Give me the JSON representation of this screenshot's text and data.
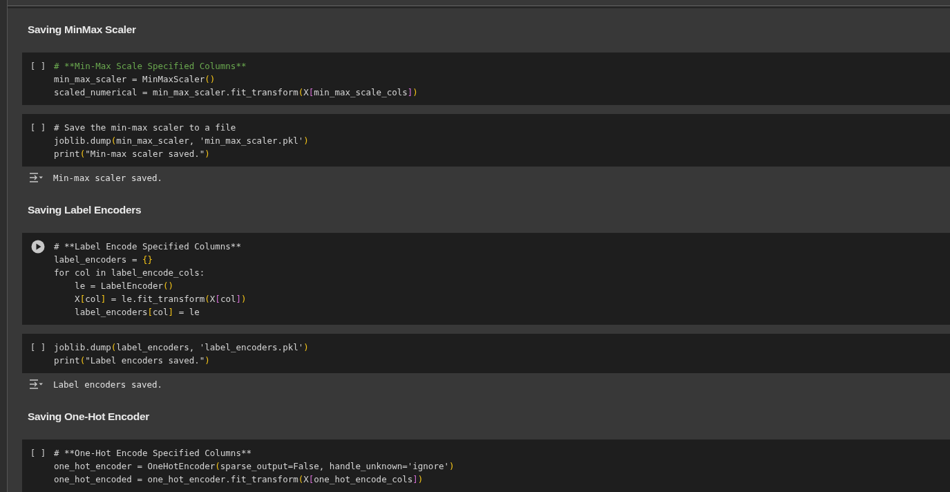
{
  "cells": [
    {
      "kind": "heading",
      "text": "Saving MinMax Scaler"
    },
    {
      "kind": "code",
      "prompt": "[ ]",
      "focused": false,
      "lines": [
        [
          {
            "text": "# **Min-Max Scale Specified Columns**",
            "kind": "comment"
          }
        ],
        [
          {
            "text": "min_max_scaler = MinMaxScaler",
            "kind": "plain"
          },
          {
            "text": "()",
            "kind": "paren"
          }
        ],
        [
          {
            "text": "scaled_numerical = min_max_scaler.fit_transform",
            "kind": "plain"
          },
          {
            "text": "(",
            "kind": "paren"
          },
          {
            "text": "X",
            "kind": "plain"
          },
          {
            "text": "[",
            "kind": "bracket"
          },
          {
            "text": "min_max_scale_cols",
            "kind": "plain"
          },
          {
            "text": "]",
            "kind": "bracket"
          },
          {
            "text": ")",
            "kind": "paren"
          }
        ]
      ]
    },
    {
      "kind": "code",
      "prompt": "[ ]",
      "focused": false,
      "lines": [
        [
          {
            "text": "# Save the min-max scaler to a file",
            "kind": "plain"
          }
        ],
        [
          {
            "text": "joblib.dump",
            "kind": "plain"
          },
          {
            "text": "(",
            "kind": "paren"
          },
          {
            "text": "min_max_scaler, 'min_max_scaler.pkl'",
            "kind": "plain"
          },
          {
            "text": ")",
            "kind": "paren"
          }
        ],
        [
          {
            "text": "print",
            "kind": "plain"
          },
          {
            "text": "(",
            "kind": "paren"
          },
          {
            "text": "\"Min-max scaler saved.\"",
            "kind": "plain"
          },
          {
            "text": ")",
            "kind": "paren"
          }
        ]
      ],
      "output": "Min-max scaler saved."
    },
    {
      "kind": "heading",
      "text": "Saving Label Encoders"
    },
    {
      "kind": "code",
      "focused": true,
      "lines": [
        [
          {
            "text": "# **Label Encode Specified Columns**",
            "kind": "plain"
          }
        ],
        [
          {
            "text": "label_encoders = ",
            "kind": "plain"
          },
          {
            "text": "{}",
            "kind": "paren"
          }
        ],
        [
          {
            "text": "for col in label_encode_cols:",
            "kind": "plain"
          }
        ],
        [
          {
            "text": "    le = LabelEncoder",
            "kind": "plain"
          },
          {
            "text": "()",
            "kind": "paren"
          }
        ],
        [
          {
            "text": "    X",
            "kind": "plain"
          },
          {
            "text": "[",
            "kind": "paren"
          },
          {
            "text": "col",
            "kind": "plain"
          },
          {
            "text": "]",
            "kind": "paren"
          },
          {
            "text": " = le.fit_transform",
            "kind": "plain"
          },
          {
            "text": "(",
            "kind": "paren"
          },
          {
            "text": "X",
            "kind": "plain"
          },
          {
            "text": "[",
            "kind": "bracket"
          },
          {
            "text": "col",
            "kind": "plain"
          },
          {
            "text": "]",
            "kind": "bracket"
          },
          {
            "text": ")",
            "kind": "paren"
          }
        ],
        [
          {
            "text": "    label_encoders",
            "kind": "plain"
          },
          {
            "text": "[",
            "kind": "paren"
          },
          {
            "text": "col",
            "kind": "plain"
          },
          {
            "text": "]",
            "kind": "paren"
          },
          {
            "text": " = le",
            "kind": "plain"
          }
        ]
      ]
    },
    {
      "kind": "code",
      "prompt": "[ ]",
      "focused": false,
      "lines": [
        [
          {
            "text": "joblib.dump",
            "kind": "plain"
          },
          {
            "text": "(",
            "kind": "paren"
          },
          {
            "text": "label_encoders, 'label_encoders.pkl'",
            "kind": "plain"
          },
          {
            "text": ")",
            "kind": "paren"
          }
        ],
        [
          {
            "text": "print",
            "kind": "plain"
          },
          {
            "text": "(",
            "kind": "paren"
          },
          {
            "text": "\"Label encoders saved.\"",
            "kind": "plain"
          },
          {
            "text": ")",
            "kind": "paren"
          }
        ]
      ],
      "output": "Label encoders saved."
    },
    {
      "kind": "heading",
      "text": "Saving One-Hot Encoder"
    },
    {
      "kind": "code",
      "prompt": "[ ]",
      "focused": false,
      "lines": [
        [
          {
            "text": "# **One-Hot Encode Specified Columns**",
            "kind": "plain"
          }
        ],
        [
          {
            "text": "one_hot_encoder = OneHotEncoder",
            "kind": "plain"
          },
          {
            "text": "(",
            "kind": "paren"
          },
          {
            "text": "sparse_output=False, handle_unknown='ignore'",
            "kind": "plain"
          },
          {
            "text": ")",
            "kind": "paren"
          }
        ],
        [
          {
            "text": "one_hot_encoded = one_hot_encoder.fit_transform",
            "kind": "plain"
          },
          {
            "text": "(",
            "kind": "paren"
          },
          {
            "text": "X",
            "kind": "plain"
          },
          {
            "text": "[",
            "kind": "bracket"
          },
          {
            "text": "one_hot_encode_cols",
            "kind": "plain"
          },
          {
            "text": "]",
            "kind": "bracket"
          },
          {
            "text": ")",
            "kind": "paren"
          }
        ]
      ]
    }
  ]
}
